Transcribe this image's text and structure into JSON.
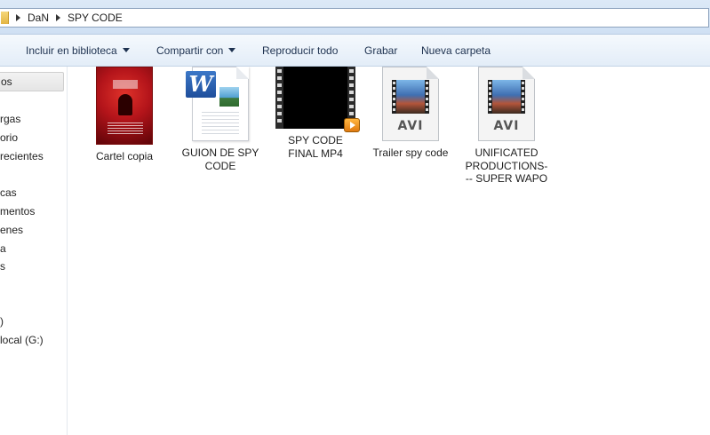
{
  "address": {
    "crumbs": [
      "DaN",
      "SPY CODE"
    ]
  },
  "toolbar": {
    "include_library": "Incluir en biblioteca",
    "share_with": "Compartir con",
    "play_all": "Reproducir todo",
    "burn": "Grabar",
    "new_folder": "Nueva carpeta"
  },
  "nav": {
    "items": [
      "os",
      "rgas",
      "orio",
      "recientes",
      "cas",
      "mentos",
      "enes",
      "a",
      "s",
      ")",
      "local (G:)"
    ]
  },
  "files": [
    {
      "name": "Cartel copia",
      "type": "image",
      "icon": "poster-thumbnail"
    },
    {
      "name": "GUION DE SPY CODE",
      "type": "document",
      "icon": "word-document-icon"
    },
    {
      "name": "SPY CODE FINAL MP4",
      "type": "video",
      "icon": "video-thumbnail"
    },
    {
      "name": "Trailer spy code",
      "type": "avi",
      "icon": "avi-file-icon",
      "ext": "AVI"
    },
    {
      "name": "UNIFICATED PRODUCTIONS--- SUPER WAPO",
      "type": "avi",
      "icon": "avi-file-icon",
      "ext": "AVI"
    }
  ]
}
